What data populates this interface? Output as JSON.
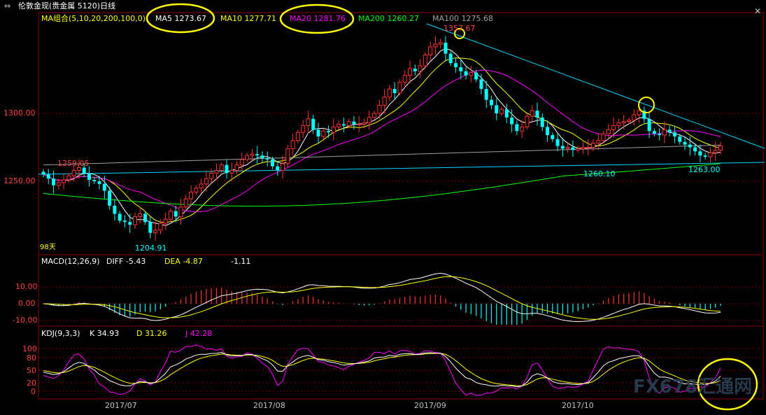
{
  "header": {
    "title": "伦敦金现(贵金属 5120)日线",
    "ma_group": "MA组合(5,10,20,200,100,0)",
    "ma5": "MA5 1273.67",
    "ma10": "MA10 1277.71",
    "ma20": "MA20 1281.76",
    "ma200": "MA200 1260.27",
    "ma100": "MA100 1275.68"
  },
  "price_panel": {
    "y_ticks": [
      "1300.00",
      "1250.00"
    ],
    "annotations": {
      "high": "1357.67",
      "left_level": "1259.05",
      "low": "1204.91",
      "mid_low": "1260.10",
      "right_low": "1263.00",
      "days": "98天"
    }
  },
  "macd_panel": {
    "label": "MACD(12,26,9)",
    "diff": "DIFF -5.43",
    "dea": "DEA -4.87",
    "macd": "-1.11",
    "y_ticks": [
      "10.00",
      "0.00",
      "-10.00"
    ]
  },
  "kdj_panel": {
    "label": "KDJ(9,3,3)",
    "k": "K 34.93",
    "d": "D 31.26",
    "j": "J 42.28",
    "y_ticks": [
      "100",
      "80",
      "50",
      "20",
      "0"
    ]
  },
  "x_axis": [
    "2017/07",
    "2017/08",
    "2017/09",
    "2017/10"
  ],
  "watermark": "FX678汇通网",
  "colors": {
    "up": "#ff3232",
    "down": "#00ffff",
    "ma5": "#ffffff",
    "ma10": "#ffff00",
    "ma20": "#ff00ff",
    "ma200": "#00ff00",
    "ma100": "#a0a0a0",
    "highlight": "#ffff00"
  },
  "chart_data": {
    "type": "candlestick",
    "closes": [
      1255,
      1252,
      1247,
      1249,
      1251,
      1254,
      1258,
      1260,
      1256,
      1251,
      1250,
      1248,
      1243,
      1232,
      1226,
      1221,
      1220,
      1218,
      1224,
      1226,
      1220,
      1212,
      1214,
      1219,
      1222,
      1228,
      1224,
      1231,
      1237,
      1242,
      1245,
      1248,
      1252,
      1256,
      1258,
      1262,
      1256,
      1258,
      1262,
      1266,
      1269,
      1270,
      1269,
      1267,
      1266,
      1261,
      1258,
      1263,
      1274,
      1280,
      1286,
      1291,
      1296,
      1288,
      1283,
      1287,
      1286,
      1290,
      1292,
      1291,
      1294,
      1292,
      1292,
      1293,
      1297,
      1300,
      1306,
      1312,
      1318,
      1315,
      1323,
      1328,
      1333,
      1331,
      1335,
      1343,
      1349,
      1351,
      1352,
      1344,
      1337,
      1334,
      1331,
      1328,
      1330,
      1325,
      1318,
      1310,
      1306,
      1300,
      1303,
      1297,
      1292,
      1287,
      1290,
      1298,
      1302,
      1297,
      1290,
      1284,
      1281,
      1276,
      1274,
      1275,
      1273,
      1274,
      1275,
      1275,
      1278,
      1280,
      1285,
      1288,
      1291,
      1293,
      1294,
      1295,
      1299,
      1302,
      1296,
      1287,
      1285,
      1284,
      1288,
      1286,
      1283,
      1279,
      1277,
      1275,
      1272,
      1269,
      1268,
      1271,
      1273,
      1276
    ]
  }
}
